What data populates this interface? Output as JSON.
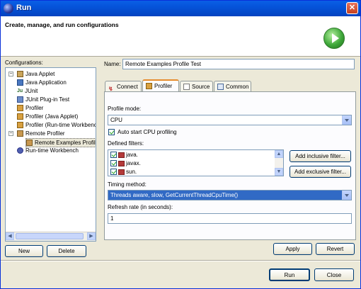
{
  "window": {
    "title": "Run",
    "close_glyph": "✕"
  },
  "banner": {
    "text": "Create, manage, and run configurations",
    "logo_icon": "run-icon"
  },
  "configurations": {
    "label": "Configurations:",
    "items": [
      {
        "label": "Java Applet",
        "icon": "java-applet-icon"
      },
      {
        "label": "Java Application",
        "icon": "java-application-icon"
      },
      {
        "label": "JUnit",
        "icon": "junit-icon"
      },
      {
        "label": "JUnit Plug-in Test",
        "icon": "junit-plugin-icon"
      },
      {
        "label": "Profiler",
        "icon": "profiler-icon"
      },
      {
        "label": "Profiler (Java Applet)",
        "icon": "profiler-icon"
      },
      {
        "label": "Profiler (Run-time Workbenc",
        "icon": "profiler-icon"
      },
      {
        "label": "Remote Profiler",
        "icon": "remote-profiler-icon"
      },
      {
        "label": "Remote Examples Profil",
        "icon": "remote-profiler-config-icon"
      },
      {
        "label": "Run-time Workbench",
        "icon": "workbench-icon"
      }
    ],
    "new_label": "New",
    "delete_label": "Delete"
  },
  "name_field": {
    "label": "Name:",
    "value": "Remote Examples Profile Test"
  },
  "tabs": [
    {
      "label": "Connect",
      "icon": "connect-icon"
    },
    {
      "label": "Profiler",
      "icon": "profiler-icon"
    },
    {
      "label": "Source",
      "icon": "source-icon"
    },
    {
      "label": "Common",
      "icon": "common-icon"
    }
  ],
  "profiler_tab": {
    "profile_mode_label": "Profile mode:",
    "profile_mode_value": "CPU",
    "auto_start_label": "Auto start CPU profiling",
    "defined_filters_label": "Defined filters:",
    "filters": [
      "java.",
      "javax.",
      "sun."
    ],
    "add_inclusive_label": "Add inclusive filter...",
    "add_exclusive_label": "Add exclusive filter...",
    "timing_method_label": "Timing method:",
    "timing_method_value": "Threads aware, slow, GetCurrentThreadCpuTime()",
    "refresh_rate_label": "Refresh rate (in seconds):",
    "refresh_rate_value": "1"
  },
  "actions": {
    "apply": "Apply",
    "revert": "Revert",
    "run": "Run",
    "close": "Close"
  }
}
